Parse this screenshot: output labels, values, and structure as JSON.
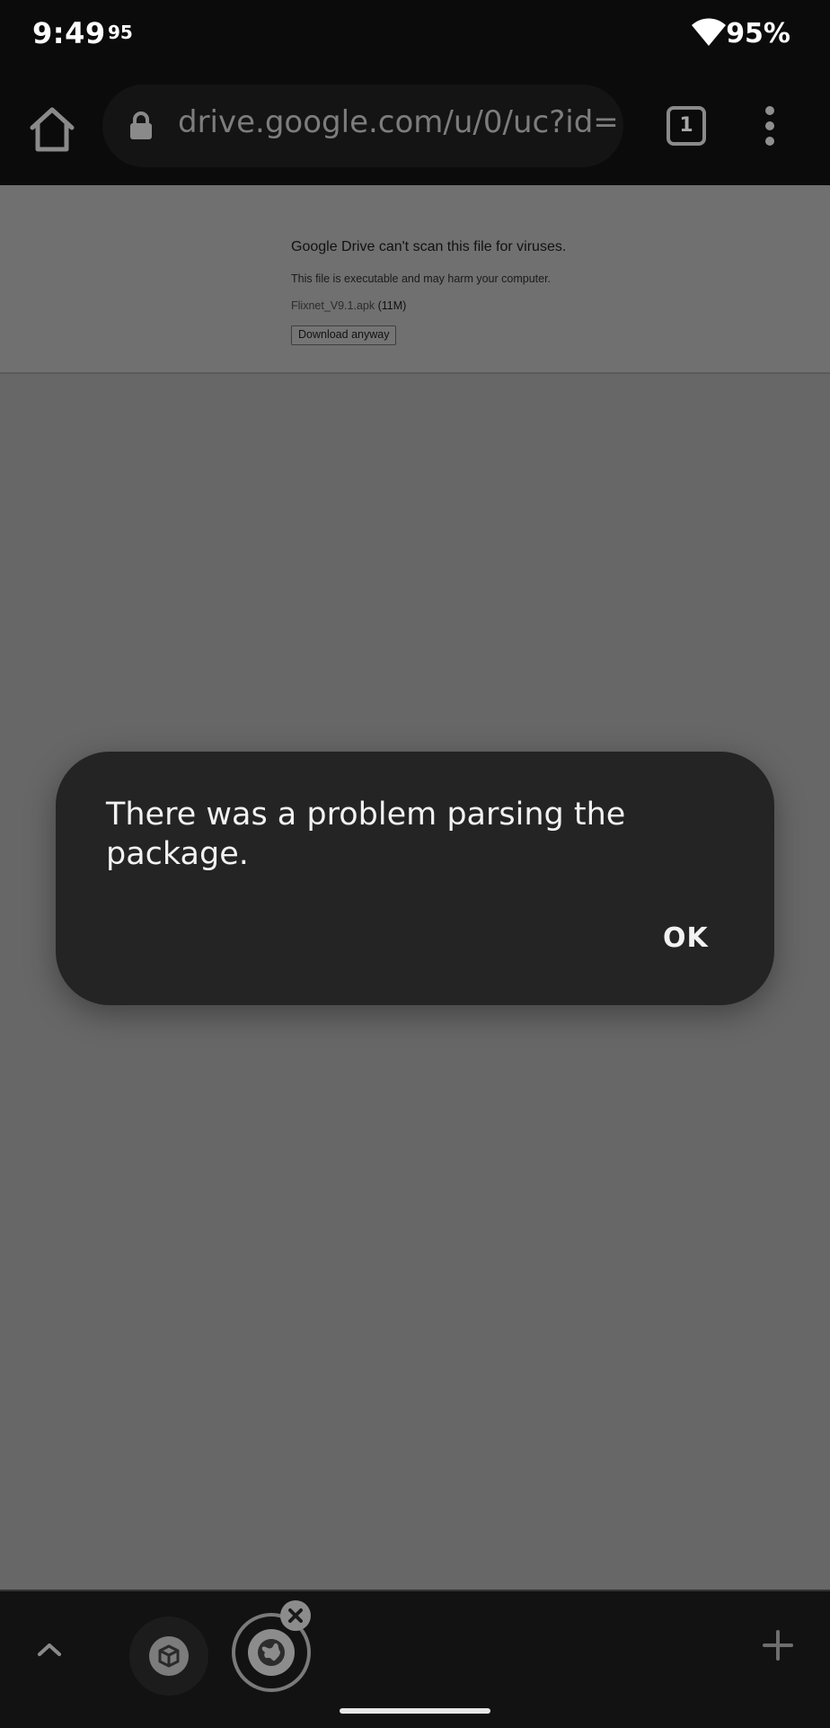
{
  "status_bar": {
    "time": "9:49",
    "extra": "95",
    "battery": "95%",
    "icons": [
      "wifi-icon"
    ]
  },
  "toolbar": {
    "url": "drive.google.com/u/0/uc?id=",
    "tab_count": "1",
    "icons": [
      "home-icon",
      "lock-icon",
      "tab-switcher-icon",
      "more-vert-icon"
    ]
  },
  "page": {
    "title": "Google Drive can't scan this file for viruses.",
    "warning": "This file is executable and may harm your computer.",
    "file_name": "Flixnet_V9.1.apk",
    "file_size": "(11M)",
    "download_button": "Download anyway"
  },
  "dialog": {
    "message": "There was a problem parsing the package.",
    "ok_button": "OK"
  },
  "bottom_bar": {
    "icons": [
      "chevron-up-icon",
      "tab-group-icon",
      "globe-icon",
      "close-icon",
      "plus-icon"
    ]
  },
  "colors": {
    "page_background": "#676767",
    "dialog_background": "#242424",
    "dialog_text": "#f2f2f2"
  }
}
